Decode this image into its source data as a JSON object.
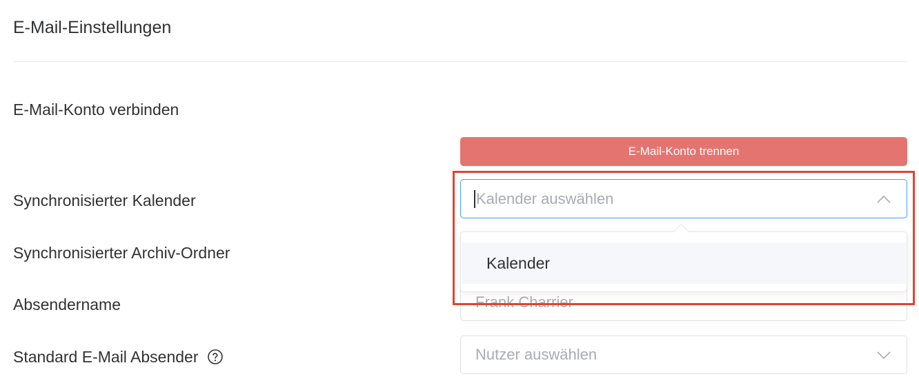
{
  "page": {
    "title": "E-Mail-Einstellungen"
  },
  "connect": {
    "label": "E-Mail-Konto verbinden",
    "disconnect_button": "E-Mail-Konto trennen"
  },
  "calendar": {
    "label": "Synchronisierter Kalender",
    "placeholder": "Kalender auswählen",
    "dropdown_open": true,
    "options": [
      "Kalender"
    ]
  },
  "archive": {
    "label": "Synchronisierter Archiv-Ordner"
  },
  "sender_name": {
    "label": "Absendername",
    "placeholder": "Frank Charrier"
  },
  "default_sender": {
    "label": "Standard E-Mail Absender",
    "placeholder": "Nutzer auswählen"
  },
  "colors": {
    "danger_button": "#e4746f",
    "focus_border": "#409eff",
    "annotation_box": "#e0442e"
  },
  "icons": {
    "calendar_select": "chevron-up-icon",
    "user_select": "chevron-down-icon",
    "help": "question-circle-icon"
  }
}
